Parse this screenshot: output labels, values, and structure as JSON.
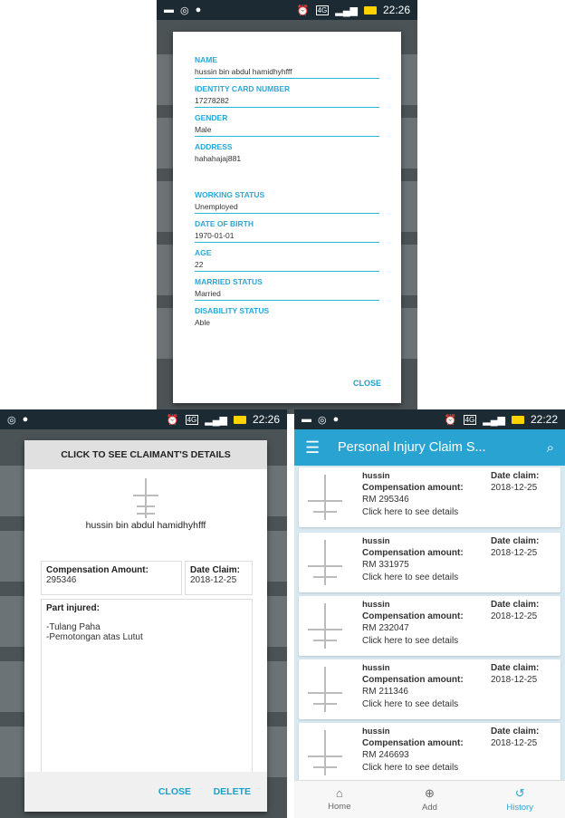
{
  "status": {
    "time_left": "22:26",
    "time_right": "22:22",
    "network": "4G"
  },
  "details_dialog": {
    "fields": [
      {
        "label": "NAME",
        "value": "hussin bin abdul hamidhyhfff"
      },
      {
        "label": "IDENTITY CARD NUMBER",
        "value": "17278282"
      },
      {
        "label": "GENDER",
        "value": "Male"
      },
      {
        "label": "ADDRESS",
        "value": "hahahajaj881"
      },
      {
        "label": "WORKING STATUS",
        "value": "Unemployed"
      },
      {
        "label": "DATE OF BIRTH",
        "value": "1970-01-01"
      },
      {
        "label": "AGE",
        "value": "22"
      },
      {
        "label": "MARRIED STATUS",
        "value": "Married"
      },
      {
        "label": "DISABILITY STATUS",
        "value": "Able"
      }
    ],
    "close": "CLOSE"
  },
  "claim_dialog": {
    "header": "CLICK TO SEE CLAIMANT'S DETAILS",
    "name": "hussin bin abdul hamidhyhfff",
    "comp_label": "Compensation Amount:",
    "comp_value": "295346",
    "date_label": "Date Claim:",
    "date_value": "2018-12-25",
    "injury_label": "Part injured:",
    "injury_1": "-Tulang Paha",
    "injury_2": "-Pemotongan atas Lutut",
    "close": "CLOSE",
    "delete": "DELETE"
  },
  "history": {
    "title": "Personal Injury Claim S...",
    "name_label": "hussin",
    "comp_label": "Compensation amount:",
    "date_label": "Date claim:",
    "link": "Click here to see details",
    "cards": [
      {
        "amount": "RM 295346",
        "date": "2018-12-25"
      },
      {
        "amount": "RM 331975",
        "date": "2018-12-25"
      },
      {
        "amount": "RM 232047",
        "date": "2018-12-25"
      },
      {
        "amount": "RM 211346",
        "date": "2018-12-25"
      },
      {
        "amount": "RM 246693",
        "date": "2018-12-25"
      }
    ],
    "nav": [
      {
        "label": "Home",
        "icon": "home-icon"
      },
      {
        "label": "Add",
        "icon": "add-circle-icon"
      },
      {
        "label": "History",
        "icon": "history-icon"
      }
    ]
  },
  "colors": {
    "accent": "#29a4d2",
    "label": "#27a8d8"
  }
}
